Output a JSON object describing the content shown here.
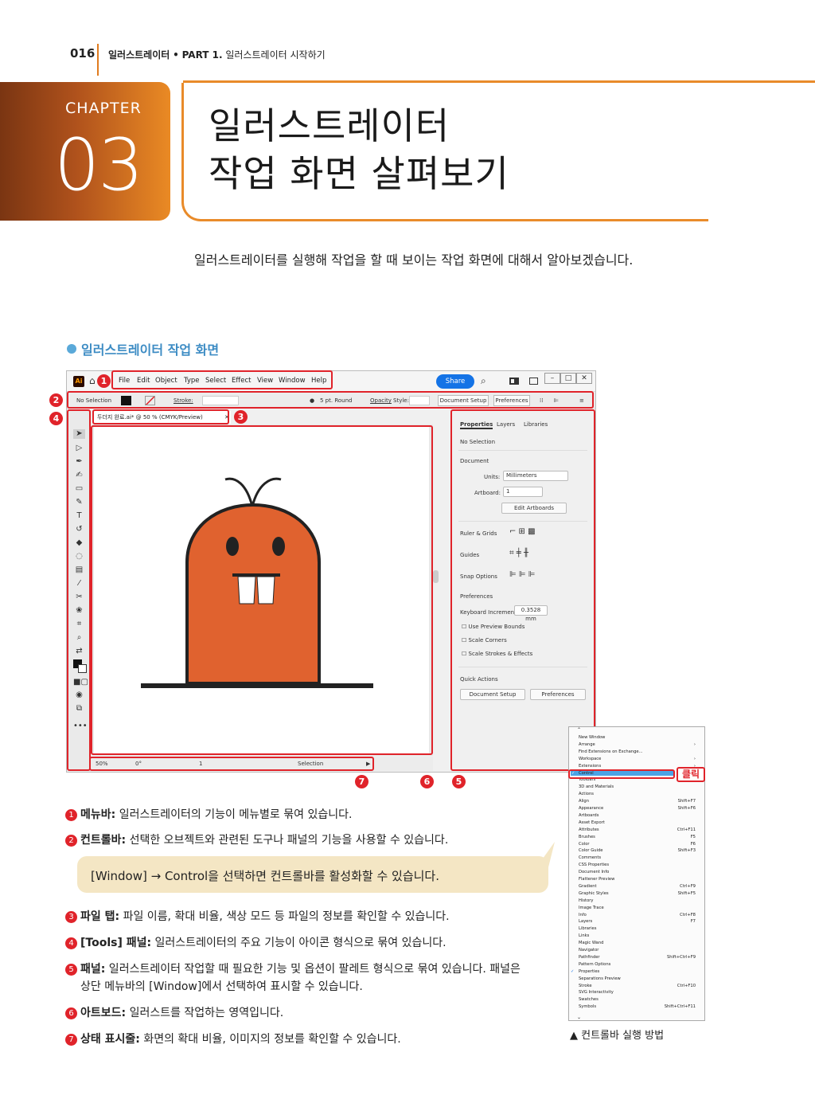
{
  "header": {
    "page_number": "016",
    "book": "일러스트레이터",
    "bullet": "•",
    "part": "PART 1.",
    "part_title": "일러스트레이터 시작하기"
  },
  "chapter": {
    "label": "CHAPTER",
    "number": "03",
    "title_line1": "일러스트레이터",
    "title_line2": "작업 화면 살펴보기"
  },
  "intro": "일러스트레이터를 실행해 작업을 할 때 보이는 작업 화면에 대해서 알아보겠습니다.",
  "section_title": "일러스트레이터 작업 화면",
  "screenshot": {
    "app_logo": "Ai",
    "menus": [
      "File",
      "Edit",
      "Object",
      "Type",
      "Select",
      "Effect",
      "View",
      "Window",
      "Help"
    ],
    "share": "Share",
    "control": {
      "no_selection": "No Selection",
      "stroke": "Stroke:",
      "brush": "5 pt. Round",
      "opacity": "Opacity",
      "style": "Style:",
      "document_setup": "Document Setup",
      "preferences": "Preferences"
    },
    "doc_tab": "두더지 완료.ai* @ 50 % (CMYK/Preview)",
    "status": {
      "zoom": "50%",
      "angle": "0°",
      "artboard": "1",
      "mode": "Selection"
    },
    "panel": {
      "tabs": [
        "Properties",
        "Layers",
        "Libraries"
      ],
      "no_selection": "No Selection",
      "document": "Document",
      "units_label": "Units:",
      "units_value": "Millimeters",
      "artboard_label": "Artboard:",
      "artboard_value": "1",
      "edit_artboards": "Edit Artboards",
      "ruler_grids": "Ruler & Grids",
      "guides": "Guides",
      "snap_options": "Snap Options",
      "preferences": "Preferences",
      "keyboard_increment": "Keyboard Increment:",
      "keyboard_value": "0.3528 mm",
      "checks": [
        "Use Preview Bounds",
        "Scale Corners",
        "Scale Strokes & Effects"
      ],
      "quick_actions": "Quick Actions",
      "document_setup": "Document Setup",
      "preferences_btn": "Preferences"
    },
    "markers": [
      "1",
      "2",
      "3",
      "4",
      "5",
      "6",
      "7"
    ]
  },
  "items": [
    {
      "num": "1",
      "title": "메뉴바:",
      "text": " 일러스트레이터의 기능이 메뉴별로 묶여 있습니다."
    },
    {
      "num": "2",
      "title": "컨트롤바:",
      "text": " 선택한 오브젝트와 관련된 도구나 패널의 기능을 사용할 수 있습니다."
    },
    {
      "num": "3",
      "title": "파일 탭:",
      "text": " 파일 이름, 확대 비율, 색상 모드 등 파일의 정보를 확인할 수 있습니다."
    },
    {
      "num": "4",
      "title": "[Tools] 패널:",
      "text": " 일러스트레이터의 주요 기능이 아이콘 형식으로 묶여 있습니다."
    },
    {
      "num": "5",
      "title": "패널:",
      "text": " 일러스트레이터 작업할 때 필요한 기능 및 옵션이 팔레트 형식으로 묶여 있습니다. 패널은",
      "text2": "상단 메뉴바의 [Window]에서 선택하여 표시할 수 있습니다."
    },
    {
      "num": "6",
      "title": "아트보드:",
      "text": " 일러스트를 작업하는 영역입니다."
    },
    {
      "num": "7",
      "title": "상태 표시줄:",
      "text": " 화면의 확대 비율, 이미지의 정보를 확인할 수 있습니다."
    }
  ],
  "tip": "[Window] → Control을 선택하면 컨트롤바를 활성화할 수 있습니다.",
  "window_menu": {
    "items": [
      {
        "label": "New Window",
        "shortcut": ""
      },
      {
        "label": "Arrange",
        "shortcut": ""
      },
      {
        "label": "Find Extensions on Exchange...",
        "shortcut": ""
      },
      {
        "label": "Workspace",
        "shortcut": ""
      },
      {
        "label": "Extensions",
        "shortcut": ""
      },
      {
        "label": "Control",
        "shortcut": ""
      },
      {
        "label": "Toolbars",
        "shortcut": ""
      },
      {
        "label": "3D and Materials",
        "shortcut": ""
      },
      {
        "label": "Actions",
        "shortcut": ""
      },
      {
        "label": "Align",
        "shortcut": "Shift+F7"
      },
      {
        "label": "Appearance",
        "shortcut": "Shift+F6"
      },
      {
        "label": "Artboards",
        "shortcut": ""
      },
      {
        "label": "Asset Export",
        "shortcut": ""
      },
      {
        "label": "Attributes",
        "shortcut": "Ctrl+F11"
      },
      {
        "label": "Brushes",
        "shortcut": "F5"
      },
      {
        "label": "Color",
        "shortcut": "F6"
      },
      {
        "label": "Color Guide",
        "shortcut": "Shift+F3"
      },
      {
        "label": "Comments",
        "shortcut": ""
      },
      {
        "label": "CSS Properties",
        "shortcut": ""
      },
      {
        "label": "Document Info",
        "shortcut": ""
      },
      {
        "label": "Flattener Preview",
        "shortcut": ""
      },
      {
        "label": "Gradient",
        "shortcut": "Ctrl+F9"
      },
      {
        "label": "Graphic Styles",
        "shortcut": "Shift+F5"
      },
      {
        "label": "History",
        "shortcut": ""
      },
      {
        "label": "Image Trace",
        "shortcut": ""
      },
      {
        "label": "Info",
        "shortcut": "Ctrl+F8"
      },
      {
        "label": "Layers",
        "shortcut": "F7"
      },
      {
        "label": "Libraries",
        "shortcut": ""
      },
      {
        "label": "Links",
        "shortcut": ""
      },
      {
        "label": "Magic Wand",
        "shortcut": ""
      },
      {
        "label": "Navigator",
        "shortcut": ""
      },
      {
        "label": "Pathfinder",
        "shortcut": "Shift+Ctrl+F9"
      },
      {
        "label": "Pattern Options",
        "shortcut": ""
      },
      {
        "label": "Properties",
        "shortcut": ""
      },
      {
        "label": "Separations Preview",
        "shortcut": ""
      },
      {
        "label": "Stroke",
        "shortcut": "Ctrl+F10"
      },
      {
        "label": "SVG Interactivity",
        "shortcut": ""
      },
      {
        "label": "Swatches",
        "shortcut": ""
      },
      {
        "label": "Symbols",
        "shortcut": "Shift+Ctrl+F11"
      }
    ],
    "click_label": "클릭",
    "caption": "▲ 컨트롤바 실행 방법"
  },
  "colors": {
    "accent_orange": "#e98b2a",
    "marker_red": "#e0232a",
    "section_blue": "#3d8cc4",
    "mole_orange": "#e0622f"
  }
}
